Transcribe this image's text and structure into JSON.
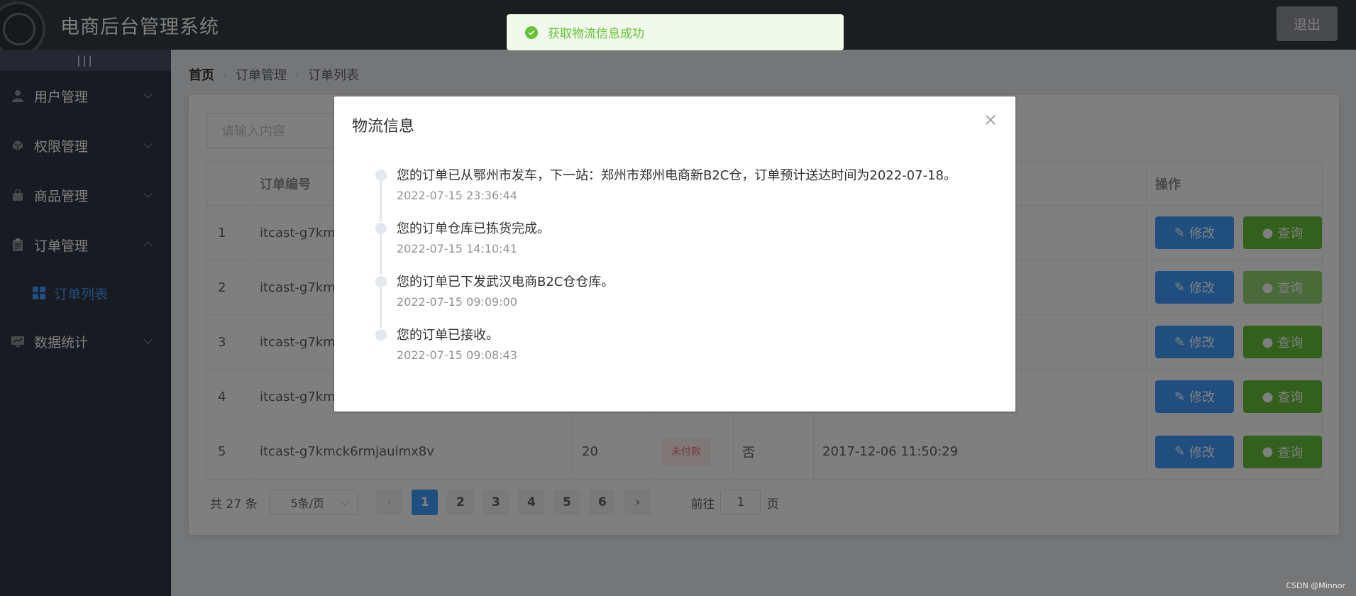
{
  "header": {
    "title": "电商后台管理系统",
    "logout_label": "退出"
  },
  "sidebar": {
    "toggle_label": "|||",
    "menus": [
      {
        "label": "用户管理",
        "icon": "user-icon"
      },
      {
        "label": "权限管理",
        "icon": "box-icon"
      },
      {
        "label": "商品管理",
        "icon": "bag-icon"
      },
      {
        "label": "订单管理",
        "icon": "clipboard-icon"
      },
      {
        "label": "数据统计",
        "icon": "chart-icon"
      }
    ],
    "submenu": {
      "label": "订单列表",
      "icon": "grid-icon"
    }
  },
  "breadcrumb": [
    "首页",
    "订单管理",
    "订单列表"
  ],
  "search": {
    "placeholder": "请输入内容"
  },
  "table": {
    "headers": {
      "order_no": "订单编号",
      "op": "操作"
    },
    "rows": [
      {
        "index": "1",
        "order_no": "itcast-g7kmc"
      },
      {
        "index": "2",
        "order_no": "itcast-g7kmc"
      },
      {
        "index": "3",
        "order_no": "itcast-g7kmc"
      },
      {
        "index": "4",
        "order_no": "itcast-g7kmc"
      },
      {
        "index": "5",
        "order_no": "itcast-g7kmck6rmjauimx8v",
        "price": "20",
        "pay_status": "未付款",
        "is_send": "否",
        "time": "2017-12-06 11:50:29"
      }
    ],
    "edit_label": "修改",
    "query_label": "查询"
  },
  "pagination": {
    "total": "共 27 条",
    "page_size": "5条/页",
    "pages": [
      "1",
      "2",
      "3",
      "4",
      "5",
      "6"
    ],
    "goto_prefix": "前往",
    "goto_value": "1",
    "goto_suffix": "页"
  },
  "dialog": {
    "title": "物流信息",
    "items": [
      {
        "content": "您的订单已从鄂州市发车，下一站：郑州市郑州电商新B2C仓，订单预计送达时间为2022-07-18。",
        "time": "2022-07-15 23:36:44"
      },
      {
        "content": "您的订单仓库已拣货完成。",
        "time": "2022-07-15 14:10:41"
      },
      {
        "content": "您的订单已下发武汉电商B2C仓仓库。",
        "time": "2022-07-15 09:09:00"
      },
      {
        "content": "您的订单已接收。",
        "time": "2022-07-15 09:08:43"
      }
    ]
  },
  "toast": {
    "message": "获取物流信息成功"
  },
  "watermark": "CSDN @Minnor",
  "colors": {
    "primary": "#409eff",
    "success": "#67c23a",
    "danger": "#f56c6c",
    "header_bg": "#373d41",
    "sidebar_bg": "#333744"
  }
}
